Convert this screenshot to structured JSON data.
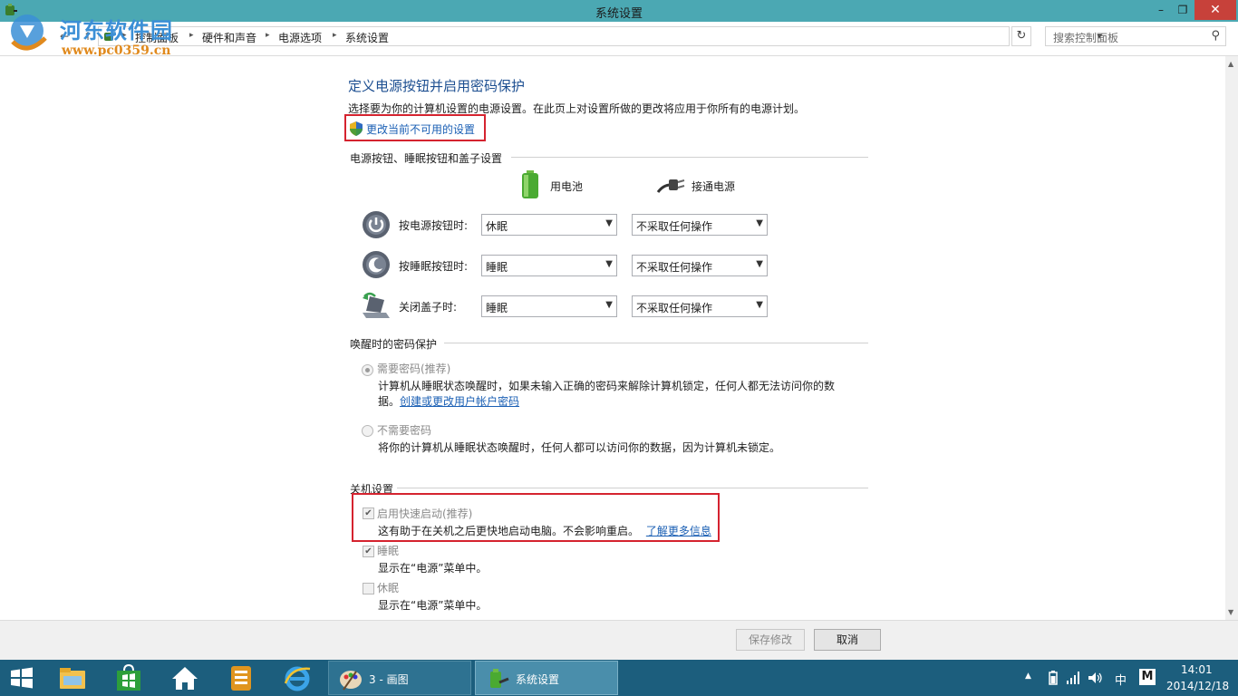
{
  "window": {
    "title": "系统设置",
    "minimize_glyph": "–",
    "maximize_glyph": "❐",
    "close_glyph": "✕"
  },
  "watermark": {
    "main": "河东软件园",
    "url": "www.pc0359.cn"
  },
  "nav": {
    "back_glyph": "←",
    "up_glyph": "↑",
    "dropdown_glyph": "▾",
    "breadcrumbs": [
      "控制面板",
      "硬件和声音",
      "电源选项",
      "系统设置"
    ],
    "search_placeholder": "搜索控制面板"
  },
  "page": {
    "title": "定义电源按钮并启用密码保护",
    "description": "选择要为你的计算机设置的电源设置。在此页上对设置所做的更改将应用于你所有的电源计划。",
    "change_link": "更改当前不可用的设置"
  },
  "buttons_group": {
    "header": "电源按钮、睡眠按钮和盖子设置",
    "col_battery": "用电池",
    "col_plugged": "接通电源",
    "rows": [
      {
        "label": "按电源按钮时:",
        "battery": "休眠",
        "plugged": "不采取任何操作"
      },
      {
        "label": "按睡眠按钮时:",
        "battery": "睡眠",
        "plugged": "不采取任何操作"
      },
      {
        "label": "关闭盖子时:",
        "battery": "睡眠",
        "plugged": "不采取任何操作"
      }
    ]
  },
  "password_group": {
    "header": "唤醒时的密码保护",
    "require": {
      "label": "需要密码(推荐)",
      "desc_line1": "计算机从睡眠状态唤醒时，如果未输入正确的密码来解除计算机锁定，任何人都无法访问你的数",
      "desc_line2_prefix": "据。",
      "desc_link": "创建或更改用户帐户密码",
      "selected": true
    },
    "no_require": {
      "label": "不需要密码",
      "desc": "将你的计算机从睡眠状态唤醒时，任何人都可以访问你的数据，因为计算机未锁定。",
      "selected": false
    }
  },
  "shutdown_group": {
    "header": "关机设置",
    "fast_startup": {
      "label": "启用快速启动(推荐)",
      "desc": "这有助于在关机之后更快地启动电脑。不会影响重启。",
      "link": "了解更多信息",
      "checked": true
    },
    "sleep": {
      "label": "睡眠",
      "desc": "显示在“电源”菜单中。",
      "checked": true
    },
    "hibernate": {
      "label": "休眠",
      "desc": "显示在“电源”菜单中。",
      "checked": false
    }
  },
  "footer": {
    "save": "保存修改",
    "cancel": "取消"
  },
  "taskbar": {
    "task_paint": "3 - 画图",
    "task_settings": "系统设置",
    "ime": "中",
    "ime_mode": "M",
    "time": "14:01",
    "date": "2014/12/18"
  }
}
